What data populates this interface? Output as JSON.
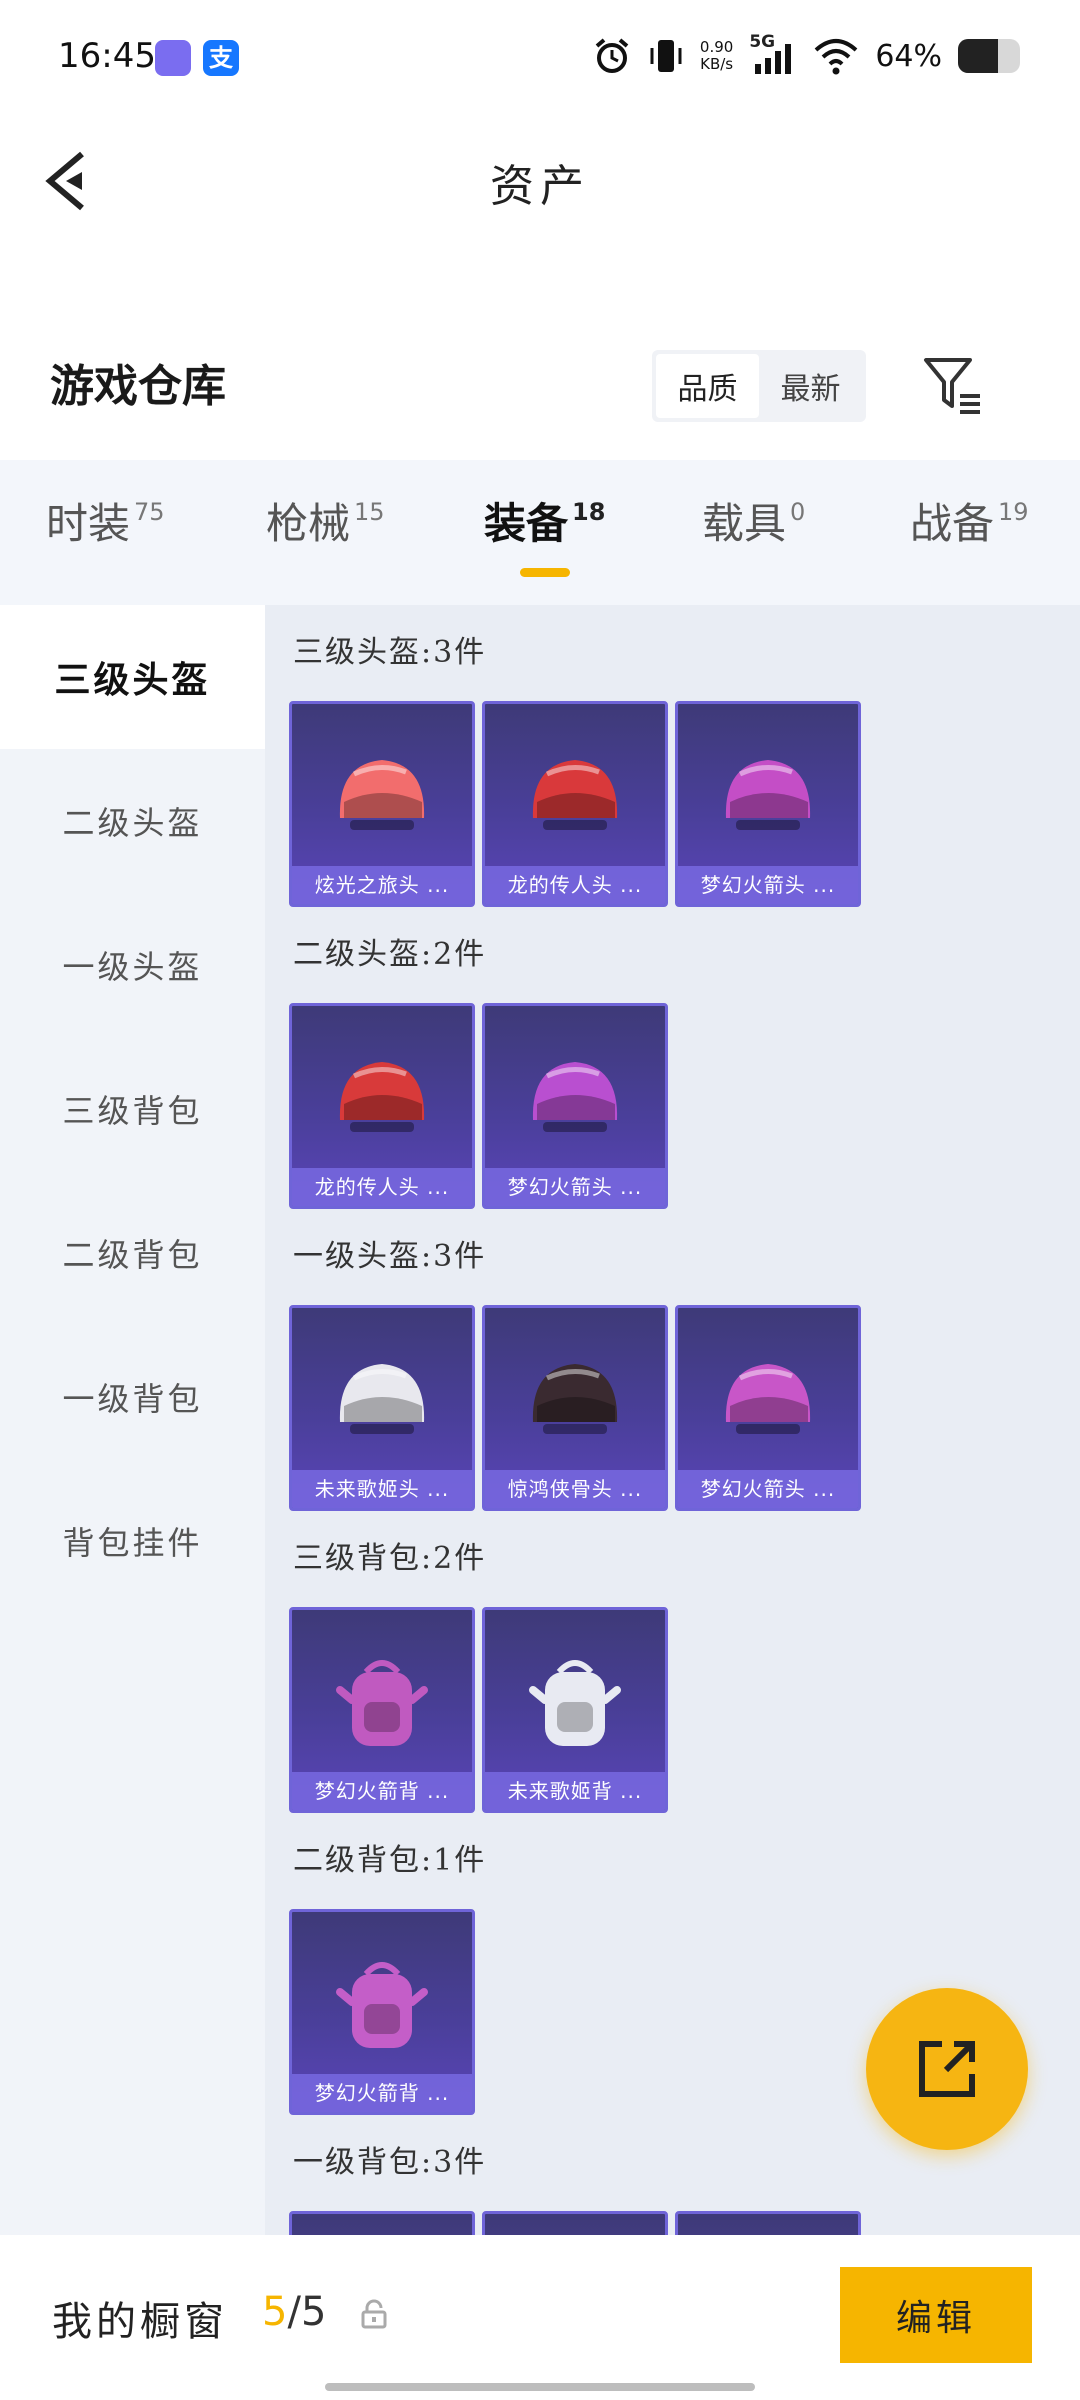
{
  "status_bar": {
    "time": "16:45",
    "alipay_label": "支",
    "net_speed_value": "0.90",
    "net_speed_unit": "KB/s",
    "network": "5G",
    "battery_text": "64%",
    "battery_level": 0.64,
    "icons": [
      "app-icon",
      "alipay-icon",
      "alarm-icon",
      "vibrate-icon",
      "signal-icon",
      "wifi-icon",
      "battery-icon"
    ]
  },
  "nav": {
    "title": "资产",
    "back_icon": "chevron-left-icon"
  },
  "warehouse": {
    "title": "游戏仓库",
    "sort_options": [
      {
        "label": "品质",
        "active": true
      },
      {
        "label": "最新",
        "active": false
      }
    ],
    "filter_icon": "filter-icon"
  },
  "tabs": [
    {
      "label": "时装",
      "count": "75"
    },
    {
      "label": "枪械",
      "count": "15"
    },
    {
      "label": "装备",
      "count": "18",
      "active": true
    },
    {
      "label": "载具",
      "count": "0"
    },
    {
      "label": "战备",
      "count": "19"
    }
  ],
  "accent_color": "#f6b500",
  "sidebar": {
    "items": [
      {
        "label": "三级头盔",
        "active": true
      },
      {
        "label": "二级头盔"
      },
      {
        "label": "一级头盔"
      },
      {
        "label": "三级背包"
      },
      {
        "label": "二级背包"
      },
      {
        "label": "一级背包"
      },
      {
        "label": "背包挂件"
      }
    ]
  },
  "groups": [
    {
      "title": "三级头盔:3件",
      "items": [
        {
          "name": "炫光之旅头 ...",
          "icon": "helmet-icon",
          "color": "#f26d6d"
        },
        {
          "name": "龙的传人头 ...",
          "icon": "helmet-icon",
          "color": "#d9393b"
        },
        {
          "name": "梦幻火箭头 ...",
          "icon": "helmet-icon",
          "color": "#c44ec6"
        }
      ]
    },
    {
      "title": "二级头盔:2件",
      "items": [
        {
          "name": "龙的传人头 ...",
          "icon": "helmet-icon",
          "color": "#d83a3a"
        },
        {
          "name": "梦幻火箭头 ...",
          "icon": "helmet-icon",
          "color": "#b94fd0"
        }
      ]
    },
    {
      "title": "一级头盔:3件",
      "items": [
        {
          "name": "未来歌姬头 ...",
          "icon": "helmet-icon",
          "color": "#e8e8ee"
        },
        {
          "name": "惊鸿侠骨头 ...",
          "icon": "helmet-icon",
          "color": "#3a2a30"
        },
        {
          "name": "梦幻火箭头 ...",
          "icon": "helmet-icon",
          "color": "#c856c8"
        }
      ]
    },
    {
      "title": "三级背包:2件",
      "items": [
        {
          "name": "梦幻火箭背 ...",
          "icon": "backpack-icon",
          "color": "#c05ac0"
        },
        {
          "name": "未来歌姬背 ...",
          "icon": "backpack-icon",
          "color": "#e8eaf2"
        }
      ]
    },
    {
      "title": "二级背包:1件",
      "items": [
        {
          "name": "梦幻火箭背 ...",
          "icon": "backpack-icon",
          "color": "#c45ec8"
        }
      ]
    },
    {
      "title": "一级背包:3件",
      "items": [
        {
          "name": "",
          "icon": "backpack-icon",
          "color": "#6a5bc8"
        },
        {
          "name": "",
          "icon": "backpack-icon",
          "color": "#6a5bc8"
        },
        {
          "name": "",
          "icon": "backpack-icon",
          "color": "#6a5bc8"
        }
      ]
    }
  ],
  "fab": {
    "icon": "share-external-icon"
  },
  "bottom_bar": {
    "label": "我的橱窗",
    "count_current": "5",
    "count_separator": "/",
    "count_total": "5",
    "lock_icon": "lock-icon",
    "edit_label": "编辑"
  }
}
